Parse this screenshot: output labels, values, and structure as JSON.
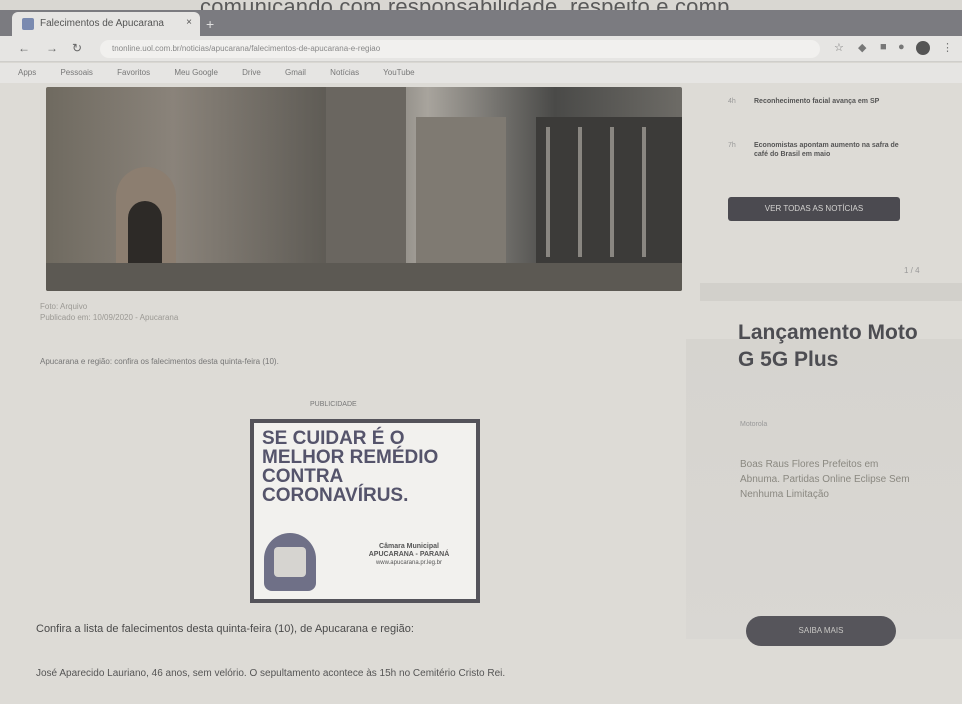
{
  "print_heading": "comunicando com responsabilidade, respeito e comp",
  "browser": {
    "tab_title": "Falecimentos de Apucarana",
    "close_glyph": "×",
    "newtab_glyph": "+",
    "url": "tnonline.uol.com.br/noticias/apucarana/falecimentos-de-apucarana-e-regiao",
    "bookmarks": [
      "Apps",
      "Pessoais",
      "Favoritos",
      "Meu Google",
      "Drive",
      "Gmail",
      "Notícias",
      "YouTube"
    ]
  },
  "article": {
    "caption_line1": "Foto: Arquivo",
    "caption_line2": "Publicado em: 10/09/2020 - Apucarana",
    "share_line": "Apucarana e região: confira os falecimentos desta quinta-feira (10).",
    "ad_label": "PUBLICIDADE",
    "ad_headline": "SE CUIDAR É O MELHOR REMÉDIO CONTRA CORONAVÍRUS.",
    "ad_org": "Câmara Municipal",
    "ad_org_sub": "APUCARANA - PARANÁ",
    "ad_site": "www.apucarana.pr.leg.br",
    "line1": "Confira a lista de falecimentos desta quinta-feira (10), de Apucarana e região:",
    "line2": "José Aparecido Lauriano, 46 anos, sem velório. O sepultamento acontece às 15h no Cemitério Cristo Rei."
  },
  "sidebar": {
    "items": [
      {
        "when": "4h",
        "text": "Reconhecimento facial avança em SP"
      },
      {
        "when": "7h",
        "text": "Economistas apontam aumento na safra de café do Brasil em maio"
      }
    ],
    "more_button": "VER TODAS AS NOTÍCIAS",
    "pager": "1 / 4",
    "promo_title": "Lançamento Moto G 5G Plus",
    "promo_meta": "Motorola",
    "promo_desc": "Boas Raus Flores Prefeitos em Abnuma. Partidas Online Eclipse Sem Nenhuma Limitação",
    "promo_button": "SAIBA MAIS"
  }
}
